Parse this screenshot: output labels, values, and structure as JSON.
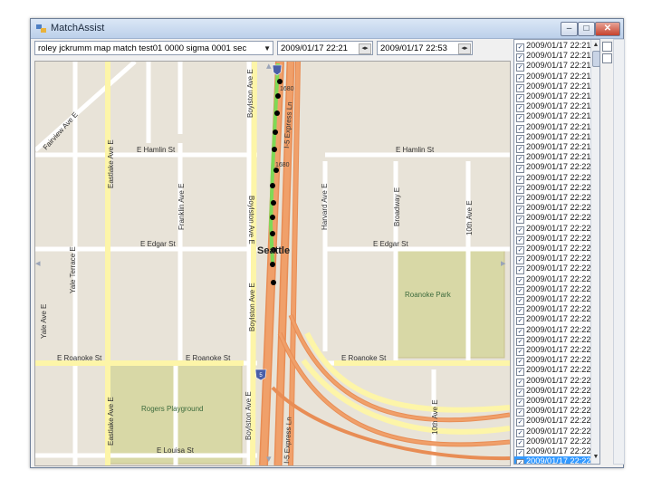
{
  "window": {
    "title": "MatchAssist",
    "minimize": "–",
    "maximize": "□",
    "close": "✕"
  },
  "toolbar": {
    "trace_select": "roley jckrumm map match test01 0000 sigma 0001 sec",
    "start_time": "2009/01/17 22:21",
    "end_time": "2009/01/17 22:53"
  },
  "map": {
    "streets": {
      "e_hamlin_st_left": "E Hamlin St",
      "e_hamlin_st_right": "E Hamlin St",
      "e_edgar_st_left": "E Edgar St",
      "e_edgar_st_right": "E Edgar St",
      "e_roanoke_st_1": "E Roanoke St",
      "e_roanoke_st_2": "E Roanoke St",
      "e_roanoke_st_3": "E Roanoke St",
      "e_louisa_st": "E Louisa St",
      "fairview_ave_e": "Fairview Ave E",
      "eastlake_ave_e_top": "Eastlake Ave E",
      "eastlake_ave_e_bottom": "Eastlake Ave E",
      "yale_terrace_e": "Yale Terrace E",
      "yale_ave_e": "Yale Ave E",
      "franklin_ave_e": "Franklin Ave E",
      "boylston_ave_e_1": "Boylston Ave E",
      "boylston_ave_e_2": "Boylston Ave E",
      "boylston_ave_e_3": "Boylston Ave E",
      "boylston_ave_e_4": "Boylston Ave E",
      "harvard_ave_e": "Harvard Ave E",
      "broadway_e": "Broadway E",
      "tenth_ave_e_top": "10th Ave E",
      "tenth_ave_e_bottom": "10th Ave E",
      "i5_express_ln_top": "I-5 Express Ln",
      "i5_express_ln_bottom": "I-5 Express Ln"
    },
    "city_label": "Seattle",
    "park_label": "Roanoke Park",
    "playground_label": "Rogers Playground",
    "route_label_1": "1680",
    "route_label_2": "1680",
    "interstate_label": "5"
  },
  "timestamps": {
    "rows": [
      "2009/01/17 22:21",
      "2009/01/17 22:21",
      "2009/01/17 22:21",
      "2009/01/17 22:21",
      "2009/01/17 22:21",
      "2009/01/17 22:21",
      "2009/01/17 22:21",
      "2009/01/17 22:21",
      "2009/01/17 22:21",
      "2009/01/17 22:21",
      "2009/01/17 22:21",
      "2009/01/17 22:21",
      "2009/01/17 22:22",
      "2009/01/17 22:22",
      "2009/01/17 22:22",
      "2009/01/17 22:22",
      "2009/01/17 22:22",
      "2009/01/17 22:22",
      "2009/01/17 22:22",
      "2009/01/17 22:22",
      "2009/01/17 22:22",
      "2009/01/17 22:22",
      "2009/01/17 22:22",
      "2009/01/17 22:22",
      "2009/01/17 22:22",
      "2009/01/17 22:22",
      "2009/01/17 22:22",
      "2009/01/17 22:22",
      "2009/01/17 22:22",
      "2009/01/17 22:22",
      "2009/01/17 22:22",
      "2009/01/17 22:22",
      "2009/01/17 22:22",
      "2009/01/17 22:22",
      "2009/01/17 22:22",
      "2009/01/17 22:22",
      "2009/01/17 22:22",
      "2009/01/17 22:22",
      "2009/01/17 22:22",
      "2009/01/17 22:22",
      "2009/01/17 22:22"
    ],
    "selected_row": "2009/01/17 22:22"
  },
  "colors": {
    "freeway": "#f0a06a",
    "arterial": "#fdf5a8",
    "street": "#ffffff",
    "park": "#d8d8a6",
    "map_bg": "#e8e3d8",
    "route_green": "#7ed957",
    "gps_point": "#000000",
    "selection": "#3399ff"
  }
}
